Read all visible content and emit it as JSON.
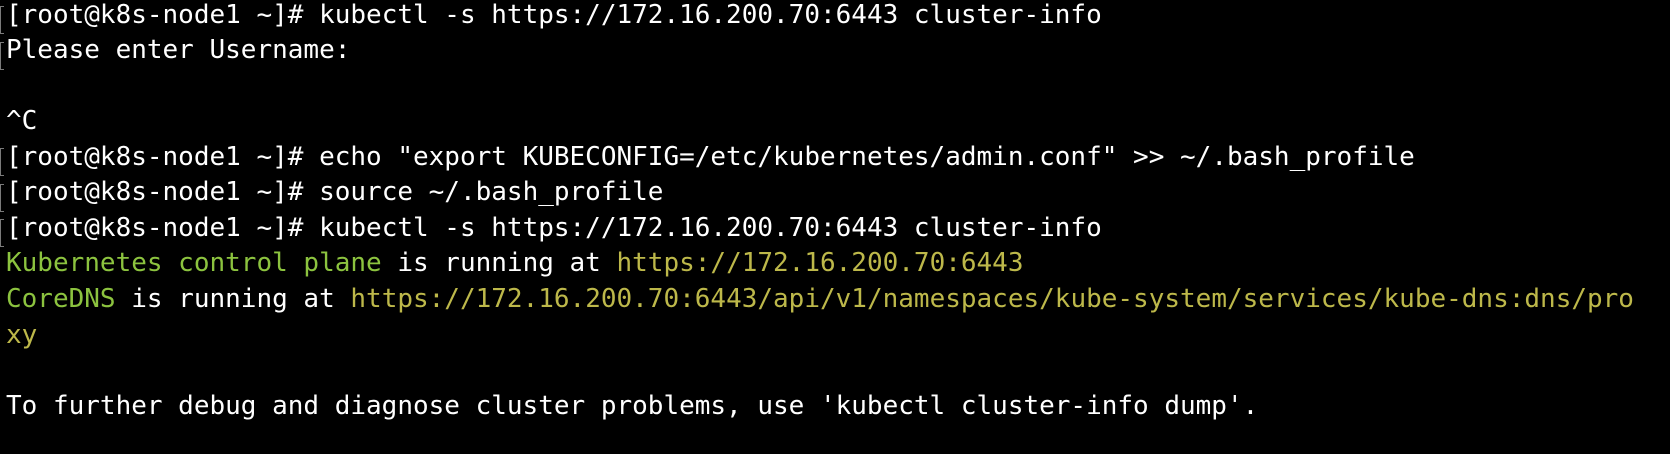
{
  "terminal": {
    "lines": [
      {
        "prompt": "[root@k8s-node1 ~]#",
        "command": " kubectl -s https://172.16.200.70:6443 cluster-info"
      },
      {
        "text": "Please enter Username:"
      },
      {
        "text": ""
      },
      {
        "text": "^C"
      },
      {
        "prompt": "[root@k8s-node1 ~]#",
        "command": " echo \"export KUBECONFIG=/etc/kubernetes/admin.conf\" >> ~/.bash_profile"
      },
      {
        "prompt": "[root@k8s-node1 ~]#",
        "command": " source ~/.bash_profile"
      },
      {
        "prompt": "[root@k8s-node1 ~]#",
        "command": " kubectl -s https://172.16.200.70:6443 cluster-info"
      },
      {
        "service": "Kubernetes control plane",
        "middle": " is running at ",
        "url": "https://172.16.200.70:6443"
      },
      {
        "service": "CoreDNS",
        "middle": " is running at ",
        "url": "https://172.16.200.70:6443/api/v1/namespaces/kube-system/services/kube-dns:dns/pro"
      },
      {
        "url": "xy"
      },
      {
        "text": ""
      },
      {
        "text": "To further debug and diagnose cluster problems, use 'kubectl cluster-info dump'."
      }
    ]
  },
  "colors": {
    "background": "#000000",
    "text": "#ffffff",
    "service": "#8cc33f",
    "url": "#bdb84a"
  }
}
